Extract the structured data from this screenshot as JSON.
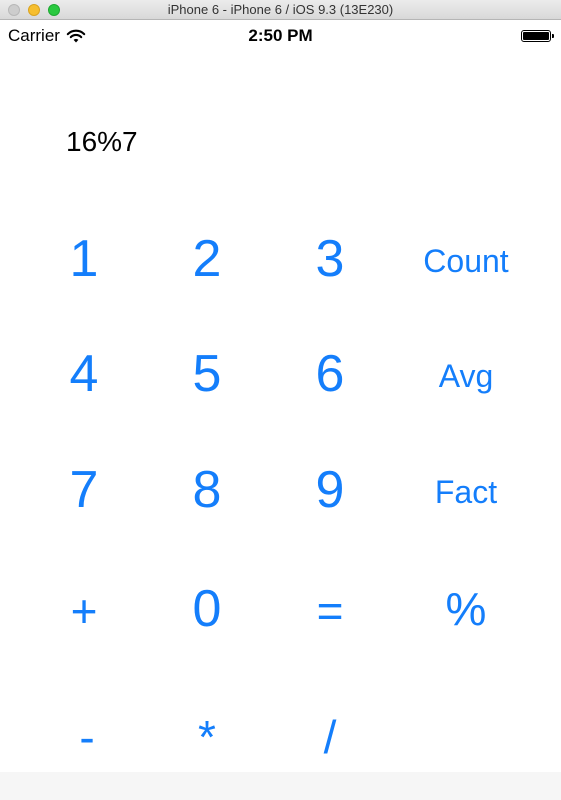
{
  "window": {
    "title": "iPhone 6 - iPhone 6 / iOS 9.3 (13E230)"
  },
  "status_bar": {
    "carrier": "Carrier",
    "time": "2:50 PM"
  },
  "display": {
    "expression": "16%7"
  },
  "keypad": {
    "one": "1",
    "two": "2",
    "three": "3",
    "count": "Count",
    "four": "4",
    "five": "5",
    "six": "6",
    "avg": "Avg",
    "seven": "7",
    "eight": "8",
    "nine": "9",
    "fact": "Fact",
    "plus": "+",
    "zero": "0",
    "equals": "=",
    "mod": "%",
    "minus": "-",
    "multiply": "*",
    "divide": "/"
  },
  "colors": {
    "accent": "#147efb",
    "text": "#000000",
    "background": "#ffffff"
  },
  "icons": [
    "wifi-icon",
    "battery-icon"
  ]
}
